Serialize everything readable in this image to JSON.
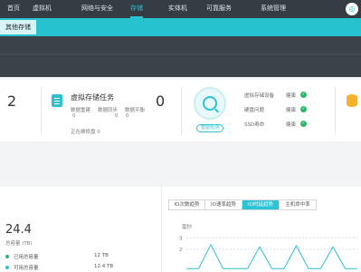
{
  "nav": {
    "items": [
      {
        "label": "首页"
      },
      {
        "label": "虚拟机"
      },
      {
        "label": "网络与安全"
      },
      {
        "label": "存储"
      },
      {
        "label": "实体机"
      },
      {
        "label": "可靠服务"
      },
      {
        "label": "系统管理"
      }
    ],
    "active_index": 3,
    "logo_icon": "shield-icon"
  },
  "subnav": {
    "tab": "其他存储"
  },
  "stats": {
    "left_count": "2",
    "task_title": "虚拟存储任务",
    "task_count": "0",
    "task_items": [
      {
        "label": "数据重建",
        "value": "0"
      },
      {
        "label": "数据同步",
        "value": "0"
      },
      {
        "label": "数据平衡",
        "value": "0"
      }
    ],
    "pending_label": "正在维修盘 0",
    "check_button": "智能检测",
    "checks": [
      {
        "label": "虚拟存储设备",
        "status": "健康"
      },
      {
        "label": "硬盘问题",
        "status": "健康"
      },
      {
        "label": "SSD寿命",
        "status": "健康"
      }
    ]
  },
  "capacity": {
    "value": "24.4",
    "label": "总容量 (TB)",
    "legend": [
      {
        "label": "已用总容量",
        "value": "12 TB",
        "color": "#2db36f"
      },
      {
        "label": "可用总容量",
        "value": "12.4 TB",
        "color": "#2fc0ce"
      }
    ]
  },
  "perf": {
    "tabs": [
      "IO次数趋势",
      "IO速率趋势",
      "IO时延趋势",
      "主机命中率"
    ],
    "active_tab": 2,
    "unit": "毫秒"
  },
  "chart_data": {
    "type": "line",
    "title": "",
    "xlabel": "",
    "ylabel": "毫秒",
    "yticks": [
      "3",
      "2"
    ],
    "series": [
      {
        "values": [
          0.3,
          0.3,
          2.4,
          0.3,
          0.3,
          0.3,
          2.2,
          0.3,
          0.3,
          2.3,
          0.3,
          0.3,
          2.2,
          0.3,
          0.3
        ]
      }
    ],
    "ylim": [
      0,
      3.5
    ],
    "grid": true
  }
}
